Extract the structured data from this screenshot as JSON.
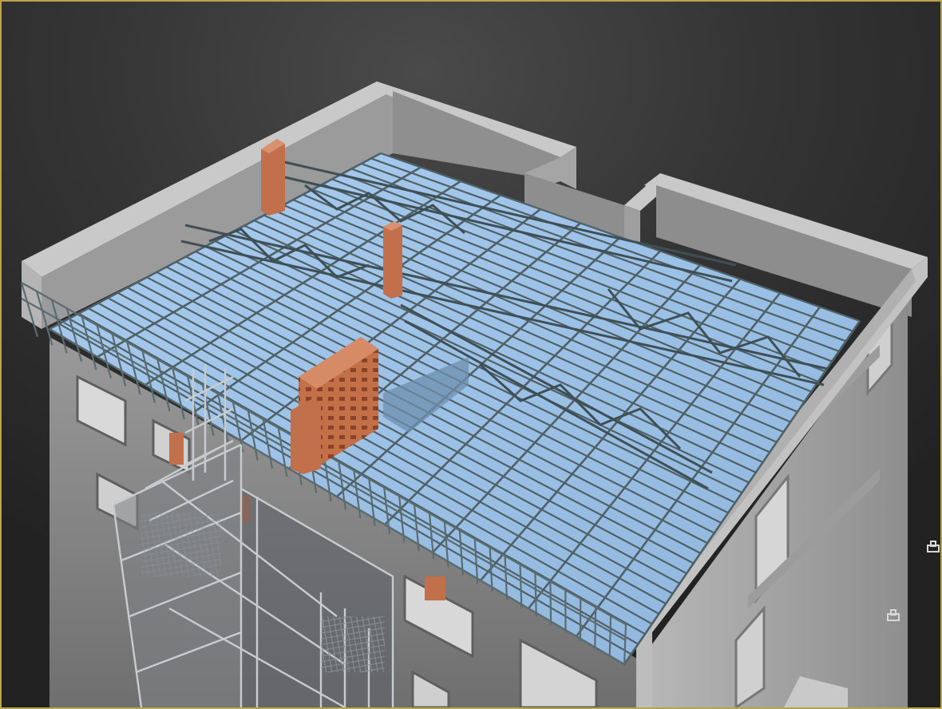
{
  "viewport": {
    "active": true,
    "border_color": "#b9a54c",
    "background_top": "#4a4a4a",
    "background_bottom": "#222222"
  },
  "scene": {
    "wall_color": "#a9a9a9",
    "wall_top_color": "#c8c8c8",
    "roof_deck_color": "#9ec2e6",
    "steel_color": "#4f6166",
    "brick_color": "#c1704b",
    "stair_color": "#c8ccd0",
    "icons": [
      "light-target-icon",
      "light-target-icon"
    ]
  }
}
